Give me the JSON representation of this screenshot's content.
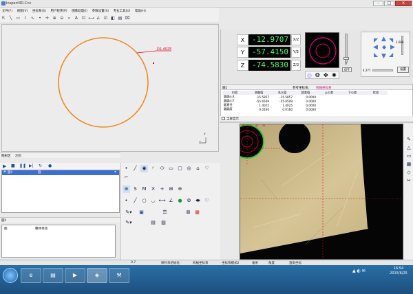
{
  "window": {
    "title": "Inspect3D-Cnc",
    "min_label": "–",
    "max_label": "□",
    "close_label": "✕"
  },
  "menu": [
    "文件(F)",
    "视图(V)",
    "坐标系(S)",
    "用户程序(P)",
    "图像处理(I)",
    "参数设置(S)",
    "专业工具(U)",
    "帮助(H)"
  ],
  "toolbar_icons": [
    "arrow-select",
    "line-draw",
    "rectangle-draw",
    "text-insert",
    "curve-draw",
    "point-measure",
    "crosshair",
    "zoom-in",
    "zoom-out",
    "magnify",
    "text-tool",
    "fit-view",
    "dimension",
    "angle",
    "checkbox",
    "layer",
    "ruler",
    "broom-clear"
  ],
  "canvas": {
    "circle_color": "#ef8a1f",
    "dimension_label": "D1.4025",
    "dimension_color": "#e6001e",
    "axis_y": "Y",
    "axis_x": "X"
  },
  "graphics_panel": {
    "tabs": [
      "图形区",
      "测图"
    ],
    "list_row": "圆1",
    "list_type": "圆"
  },
  "left_tool_rows": {
    "row1": [
      "arrow-icon",
      "line-icon",
      "circle-icon",
      "arc-icon",
      "ellipse-icon",
      "rectangle-icon",
      "slot-icon",
      "ring-icon",
      "polyline-icon",
      "curve-icon"
    ],
    "row2": [
      "target-icon",
      "s-icon",
      "m-icon",
      "intersect-icon",
      "plus-icon",
      "move-icon",
      "add-icon"
    ],
    "row3": [
      "arrow-icon",
      "line-icon",
      "circle-icon",
      "arc-icon",
      "distance-icon",
      "angle-icon",
      "green-dot-icon",
      "gear-icon",
      "slot-icon",
      "curve-icon"
    ],
    "row4": [
      "pen-icon",
      "save-icon",
      "report-icon",
      "color-icon"
    ],
    "row5": [
      "pen-icon",
      "clipboard-icon",
      "image-icon"
    ]
  },
  "info_panel": {
    "title": "圆1",
    "col1": "图",
    "col2": "整体寻动"
  },
  "dro": {
    "x_label": "X",
    "x_value": "-12.9707",
    "x_unit": "X/2",
    "y_label": "Y",
    "y_value": "-57.4150",
    "y_unit": "Y/2",
    "z_label": "Z",
    "z_value": "-74.5830",
    "z_unit": "Z/2",
    "off_label": "OFF",
    "light_value": "0"
  },
  "motion": {
    "speed_a": "2.668",
    "speed_b": "4.277",
    "set_label": "设置"
  },
  "results": {
    "header_title": "圆1",
    "coord_label": "参考坐标系：",
    "coord_value": "机械坐标系",
    "columns": [
      "内容",
      "测量值",
      "名义值",
      "超差值",
      "上公差",
      "下公差",
      "状态"
    ],
    "rows": [
      [
        "圆圆心X",
        "-15.5857",
        "-15.5857",
        "0.0000",
        "",
        "",
        ""
      ],
      [
        "圆圆心Y",
        "-55.6509",
        "-55.6509",
        "0.0000",
        "",
        "",
        ""
      ],
      [
        "圆直径",
        "1.4025",
        "1.4025",
        "0.0000",
        "",
        "",
        ""
      ],
      [
        "圆圆度",
        "0.0160",
        "0.0160",
        "0.0000",
        "",
        "",
        ""
      ]
    ],
    "fullscreen_label": "全屏显示"
  },
  "camera_tools": [
    "pen-icon",
    "triangle-icon",
    "rect-icon",
    "grid-icon",
    "diamond-icon",
    "cut-icon"
  ],
  "statusbar": {
    "coord": "0.7",
    "mode": "探针未初始化",
    "machine": "机械坐标系",
    "coord_mode": "坐标系模式2",
    "unit": "毫米",
    "angle": "角度",
    "cartesian": "直角坐标"
  },
  "taskbar": {
    "time": "16:54",
    "date": "2015/6/25"
  }
}
